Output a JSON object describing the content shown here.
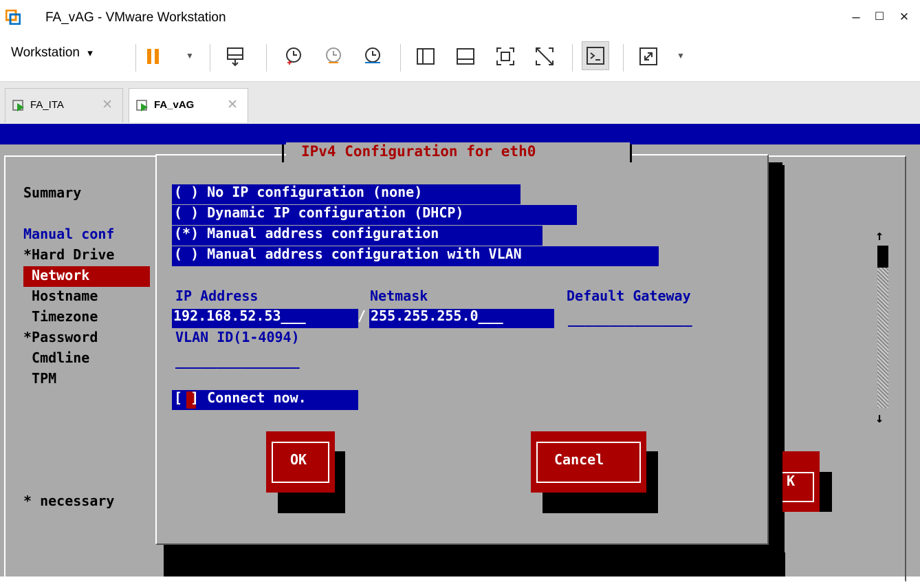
{
  "window": {
    "title": "FA_vAG - VMware Workstation",
    "minimize": "–",
    "maximize": "☐",
    "close": "✕"
  },
  "toolbar": {
    "menu_label": "Workstation",
    "menu_arrow": "▾"
  },
  "tabs": [
    {
      "label": "FA_ITA",
      "close": "✕",
      "active": false
    },
    {
      "label": "FA_vAG",
      "close": "✕",
      "active": true
    }
  ],
  "background_menu": {
    "items": [
      {
        "label": "Summary"
      },
      {
        "label": "Manual conf"
      },
      {
        "label": "*Hard Drive"
      },
      {
        "label": " Network",
        "selected": true
      },
      {
        "label": " Hostname"
      },
      {
        "label": " Timezone"
      },
      {
        "label": "*Password"
      },
      {
        "label": " Cmdline"
      },
      {
        "label": " TPM"
      }
    ],
    "footer_note": "* necessary",
    "ok_fragment": "K",
    "scroll_up": "↑",
    "scroll_down": "↓"
  },
  "dialog": {
    "title": "IPv4 Configuration for eth0",
    "options": [
      {
        "label": "( ) No IP configuration (none)"
      },
      {
        "label": "( ) Dynamic IP configuration (DHCP)"
      },
      {
        "label": "(*) Manual address configuration"
      },
      {
        "label": "( ) Manual address configuration with VLAN"
      }
    ],
    "fields": {
      "ip_label": "IP Address",
      "ip_value": "192.168.52.53___",
      "separator": "/",
      "netmask_label": "Netmask",
      "netmask_value": "255.255.255.0___",
      "gateway_label": "Default Gateway",
      "gateway_value": "_______________",
      "vlan_label": "VLAN ID(1-4094)",
      "vlan_value": "_______________"
    },
    "connect_now": "[ ] Connect now.",
    "ok_button": "OK",
    "cancel_button": "Cancel"
  },
  "colors": {
    "vm_blue": "#0000a8",
    "vm_red": "#aa0000",
    "vm_gray": "#aaaaaa",
    "vmware_orange": "#f38b00",
    "pause_orange": "#f38b00"
  }
}
